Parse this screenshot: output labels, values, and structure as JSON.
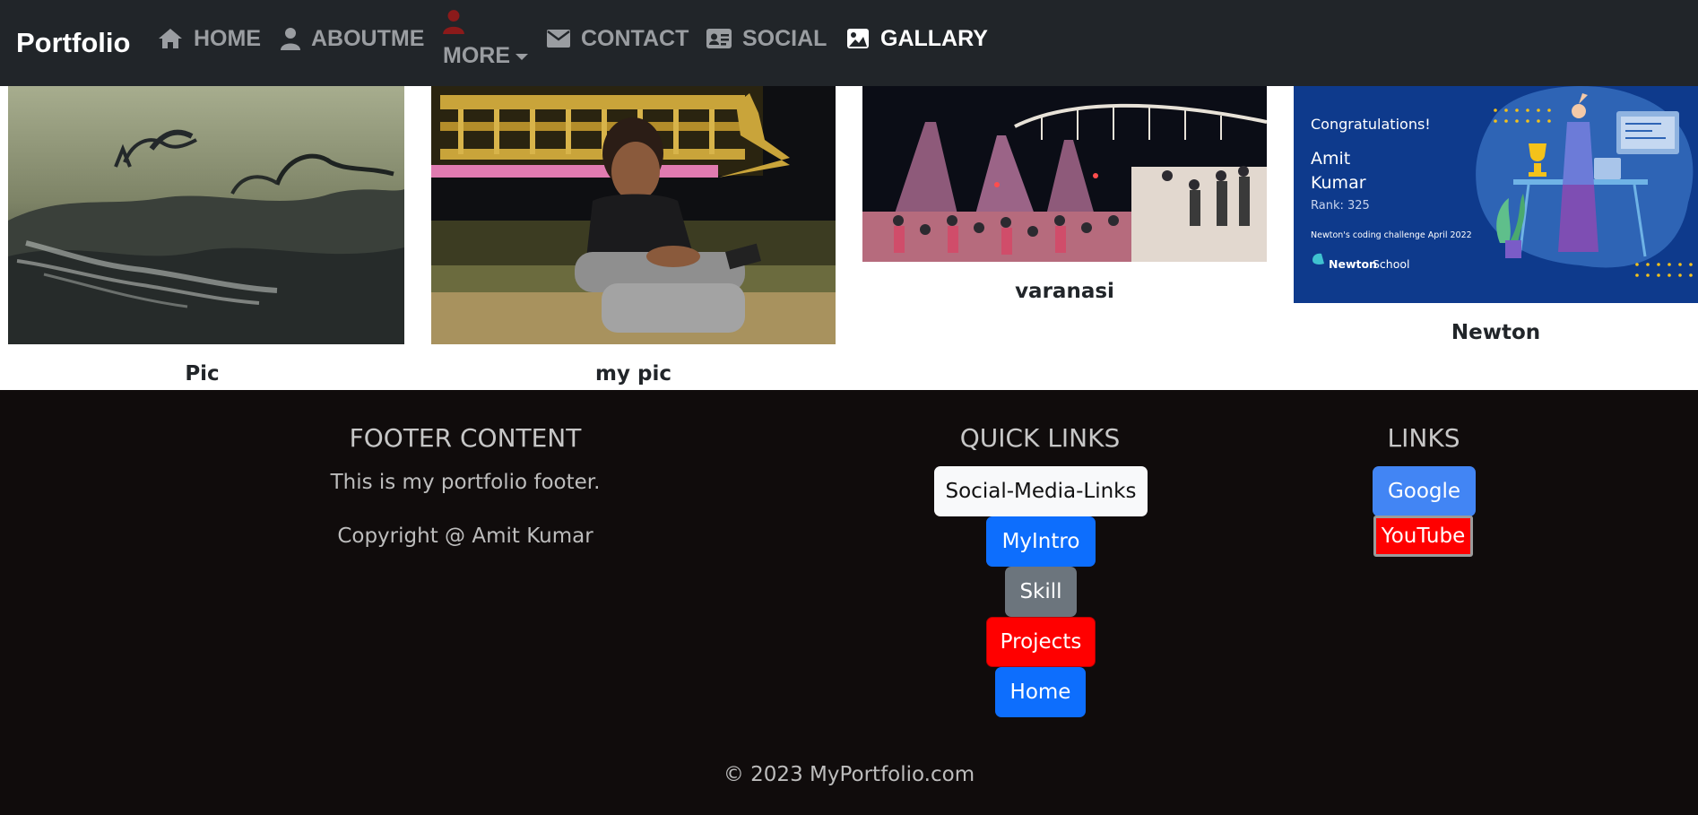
{
  "nav": {
    "brand": "Portfolio",
    "items": [
      {
        "label": "HOME",
        "icon": "home-icon"
      },
      {
        "label": "ABOUTME",
        "icon": "user-icon"
      },
      {
        "label": "MORE",
        "icon": "user-icon"
      },
      {
        "label": "CONTACT",
        "icon": "envelope-icon"
      },
      {
        "label": "SOCIAL",
        "icon": "id-card-icon"
      },
      {
        "label": "GALLARY",
        "icon": "image-icon"
      }
    ],
    "colors": {
      "bg": "#212529",
      "link": "#9a9da1",
      "active": "#ffffff",
      "more_icon": "#8b1a1a"
    }
  },
  "gallery": {
    "cards": [
      {
        "title": "Pic"
      },
      {
        "title": "my pic"
      },
      {
        "title": "varanasi"
      },
      {
        "title": "Newton"
      }
    ],
    "certificate": {
      "heading": "Congratulations!",
      "name_line1": "Amit",
      "name_line2": "Kumar",
      "rank": "Rank: 325",
      "event": "Newton's coding challenge April 2022",
      "org_bold": "Newton",
      "org_rest": " School"
    }
  },
  "footer": {
    "content_heading": "FOOTER CONTENT",
    "content_text": "This is my portfolio footer.",
    "content_copyright": "Copyright @ Amit Kumar",
    "quick_heading": "QUICK LINKS",
    "quick_links": [
      "Social-Media-Links",
      "MyIntro",
      "Skill",
      "Projects",
      "Home"
    ],
    "links_heading": "LINKS",
    "links": [
      "Google",
      "YouTube"
    ],
    "copyright": "© 2023 MyPortfolio.com",
    "colors": {
      "bg": "#100c0c",
      "primary": "#0d6efd",
      "secondary": "#6c757d",
      "danger": "#ff0000",
      "google": "#4285f4"
    }
  }
}
